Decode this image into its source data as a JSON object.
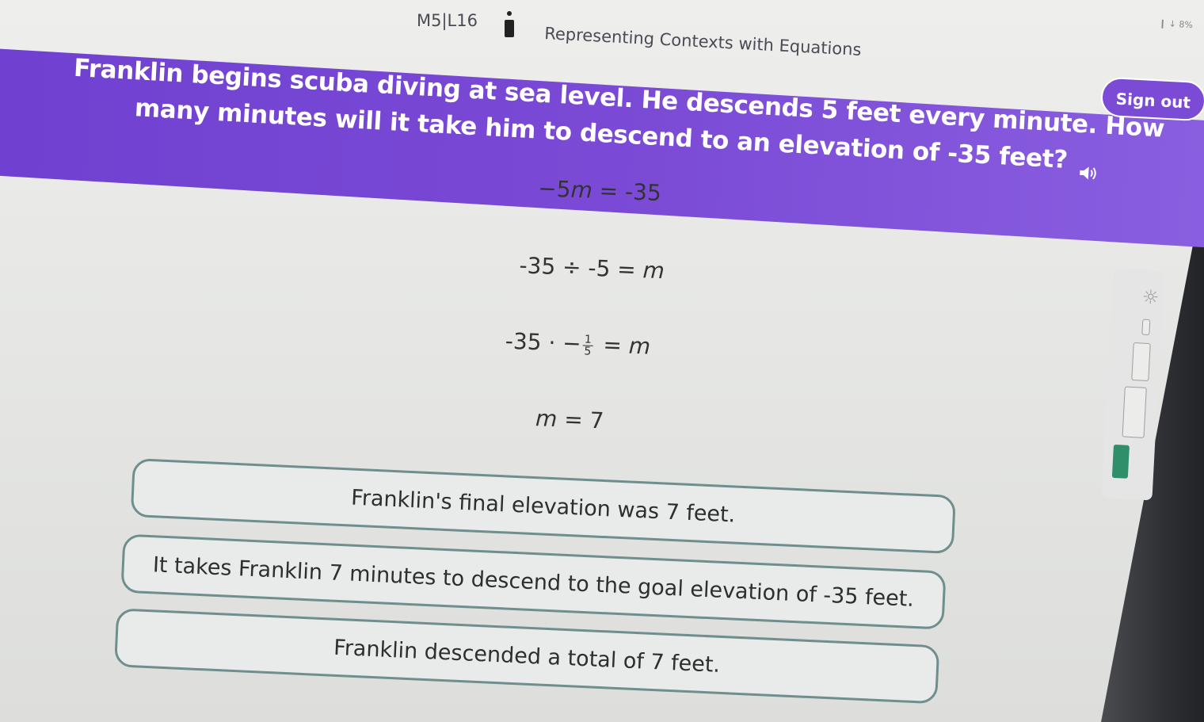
{
  "header": {
    "lesson_code": "M5|L16",
    "lesson_title": "Representing Contexts with Equations",
    "status_text": "❙ ↓ 8%",
    "sign_out_label": "Sign out"
  },
  "question": {
    "text": "Franklin begins scuba diving at sea level. He descends 5 feet every minute. How many minutes will it take him to descend to an elevation of -35 feet?"
  },
  "steps": {
    "step1": {
      "left": "−5",
      "var": "m",
      "right": " = -35"
    },
    "step2": {
      "left": "-35 ÷ -5 = ",
      "var": "m"
    },
    "step3": {
      "left": "-35 · −",
      "num": "1",
      "den": "5",
      "right": " = ",
      "var": "m"
    },
    "step4": {
      "var": "m",
      "right": " = 7"
    }
  },
  "options": [
    {
      "label": "Franklin's final elevation was 7 feet."
    },
    {
      "label": "It takes Franklin 7 minutes to descend to the goal elevation of -35 feet."
    },
    {
      "label": "Franklin descended a total of 7 feet."
    }
  ],
  "colors": {
    "banner": "#7b4bd6",
    "option_border": "#6f8f8c",
    "tool_active": "#2f8f6a"
  }
}
